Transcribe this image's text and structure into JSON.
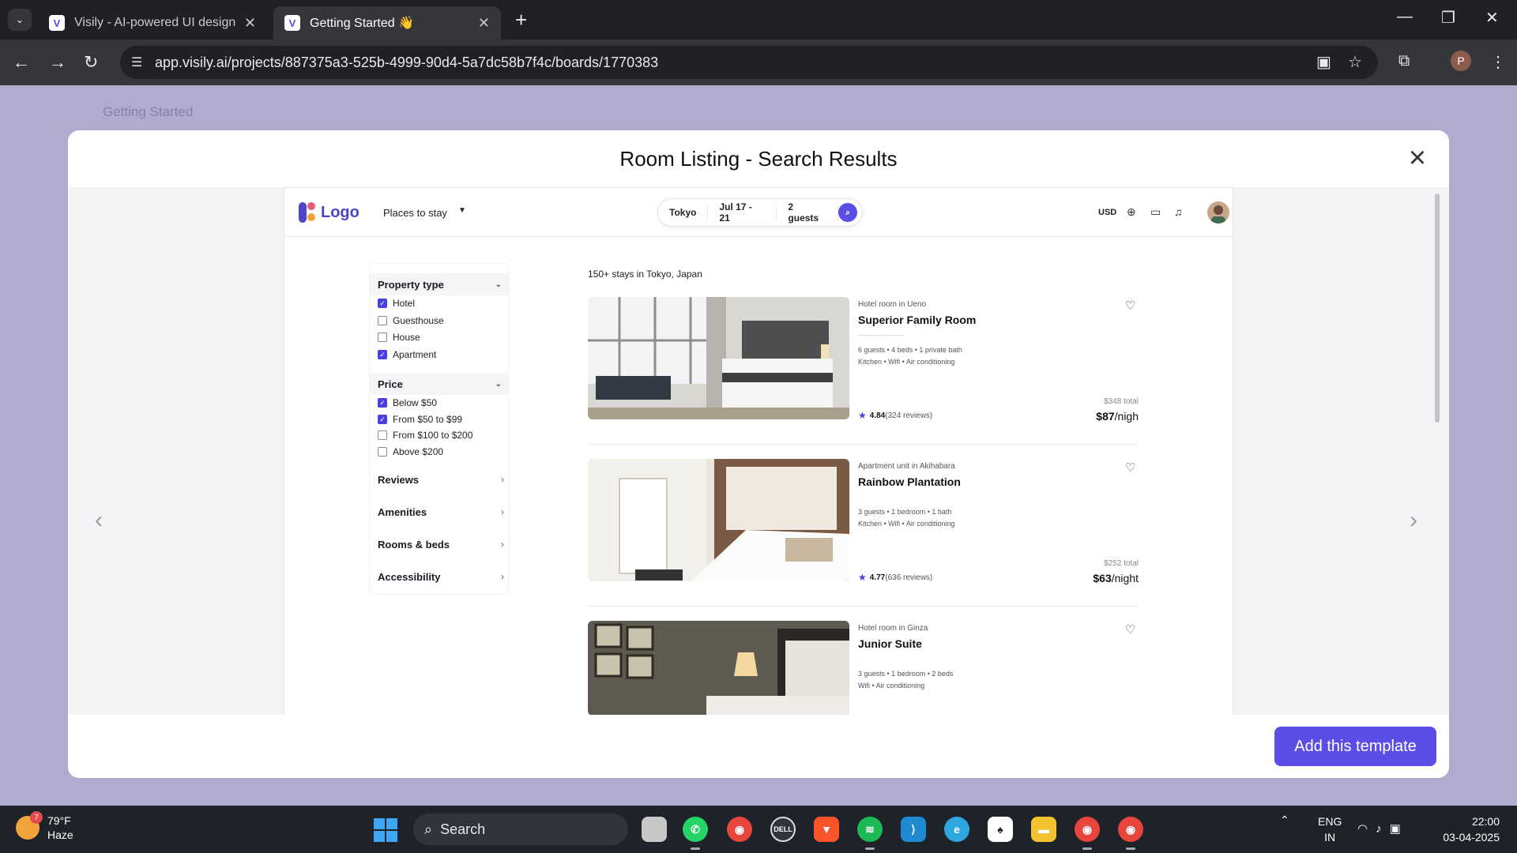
{
  "browser": {
    "tabs": [
      {
        "title": "Visily - AI-powered UI design so",
        "active": false
      },
      {
        "title": "Getting Started 👋",
        "active": true
      }
    ],
    "url": "app.visily.ai/projects/887375a3-525b-4999-90d4-5a7dc58b7f4c/boards/1770383",
    "profile_initial": "P"
  },
  "backdrop": {
    "project_title": "Getting Started"
  },
  "modal": {
    "title": "Room Listing - Search Results",
    "add_button": "Add this template"
  },
  "preview": {
    "logo": "Logo",
    "places": "Places to stay",
    "search": {
      "location": "Tokyo",
      "dates": "Jul 17 - 21",
      "guests": "2 guests"
    },
    "currency": "USD",
    "filters": {
      "property_type": {
        "title": "Property type",
        "options": [
          {
            "label": "Hotel",
            "checked": true
          },
          {
            "label": "Guesthouse",
            "checked": false
          },
          {
            "label": "House",
            "checked": false
          },
          {
            "label": "Apartment",
            "checked": true
          }
        ]
      },
      "price": {
        "title": "Price",
        "options": [
          {
            "label": "Below $50",
            "checked": true
          },
          {
            "label": "From $50 to $99",
            "checked": true
          },
          {
            "label": "From $100 to $200",
            "checked": false
          },
          {
            "label": "Above $200",
            "checked": false
          }
        ]
      },
      "sections": [
        "Reviews",
        "Amenities",
        "Rooms & beds",
        "Accessibility"
      ]
    },
    "result_count": "150+ stays in Tokyo, Japan",
    "listings": [
      {
        "subtitle": "Hotel room in Ueno",
        "title": "Superior Family Room",
        "details1": "6 guests • 4 beds • 1 private bath",
        "details2": "Kitchen • Wifi • Air conditioning",
        "rating": "4.84",
        "reviews": "(324 reviews)",
        "total": "$348 total",
        "price": "$87",
        "per": "/nigh"
      },
      {
        "subtitle": "Apartment unit in Akihabara",
        "title": "Rainbow Plantation",
        "details1": "3 guests • 1 bedroom • 1 bath",
        "details2": "Kitchen • Wifi • Air conditioning",
        "rating": "4.77",
        "reviews": "(636 reviews)",
        "total": "$252 total",
        "price": "$63",
        "per": "/night"
      },
      {
        "subtitle": "Hotel room in Ginza",
        "title": "Junior Suite",
        "details1": "3 guests • 1 bedroom • 2 beds",
        "details2": "Wifi • Air conditioning",
        "rating": "",
        "reviews": "",
        "total": "",
        "price": "",
        "per": ""
      }
    ]
  },
  "taskbar": {
    "weather": {
      "temp": "79°F",
      "desc": "Haze",
      "badge": "7"
    },
    "search_label": "Search",
    "lang": {
      "line1": "ENG",
      "line2": "IN"
    },
    "clock": {
      "time": "22:00",
      "date": "03-04-2025"
    }
  },
  "colors": {
    "accent": "#5b4ee6",
    "checkbox": "#4a3fe0",
    "chrome_dark": "#202124"
  }
}
